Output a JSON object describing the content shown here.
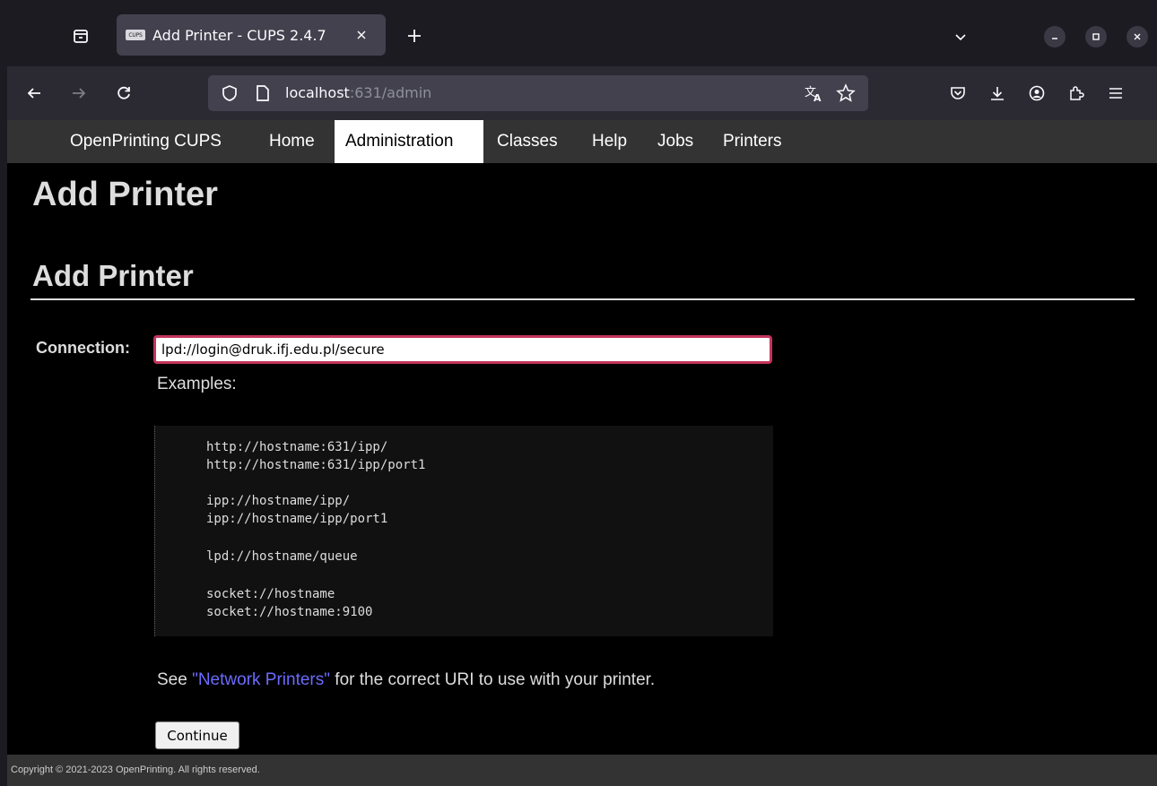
{
  "browser": {
    "tab": {
      "favicon_text": "CUPS",
      "title": "Add Printer - CUPS 2.4.7"
    },
    "url": {
      "host": "localhost",
      "rest": ":631/admin"
    }
  },
  "cups_nav": {
    "items": [
      {
        "label": "OpenPrinting CUPS"
      },
      {
        "label": "Home"
      },
      {
        "label": "Administration"
      },
      {
        "label": "Classes"
      },
      {
        "label": "Help"
      },
      {
        "label": "Jobs"
      },
      {
        "label": "Printers"
      }
    ]
  },
  "page": {
    "title": "Add Printer",
    "section_title": "Add Printer",
    "connection_label": "Connection:",
    "connection_value": "lpd://login@druk.ifj.edu.pl/secure",
    "examples_label": "Examples:",
    "examples": [
      "http://hostname:631/ipp/",
      "http://hostname:631/ipp/port1",
      "ipp://hostname/ipp/",
      "ipp://hostname/ipp/port1",
      "lpd://hostname/queue",
      "socket://hostname",
      "socket://hostname:9100"
    ],
    "see_prefix": "See ",
    "see_link": "\"Network Printers\"",
    "see_suffix": " for the correct URI to use with your printer.",
    "continue_label": "Continue"
  },
  "footer": {
    "text": "Copyright © 2021-2023 OpenPrinting. All rights reserved."
  },
  "colors": {
    "accent_border": "#c4345c",
    "link": "#6b6bff",
    "nav_bg": "#333333",
    "page_bg": "#000000"
  }
}
